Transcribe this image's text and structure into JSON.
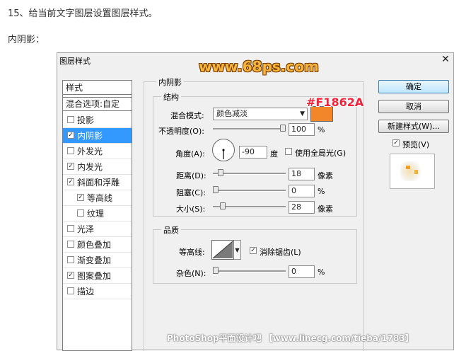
{
  "article": {
    "step_text": "15、给当前文字图层设置图层样式。",
    "section_label": "内阴影："
  },
  "dialog": {
    "title": "图层样式",
    "close_glyph": "✕",
    "watermark_top": "www.68ps.com",
    "watermark_bottom": "PhotoShop平面设计吧 【www.linecg.com/tieba/1783】"
  },
  "styles_panel": {
    "header": "样式",
    "blend_options": "混合选项:自定",
    "items": [
      {
        "label": "投影",
        "checked": false,
        "selected": false,
        "indent": false
      },
      {
        "label": "内阴影",
        "checked": true,
        "selected": true,
        "indent": false
      },
      {
        "label": "外发光",
        "checked": false,
        "selected": false,
        "indent": false
      },
      {
        "label": "内发光",
        "checked": true,
        "selected": false,
        "indent": false
      },
      {
        "label": "斜面和浮雕",
        "checked": true,
        "selected": false,
        "indent": false
      },
      {
        "label": "等高线",
        "checked": true,
        "selected": false,
        "indent": true
      },
      {
        "label": "纹理",
        "checked": false,
        "selected": false,
        "indent": true
      },
      {
        "label": "光泽",
        "checked": false,
        "selected": false,
        "indent": false
      },
      {
        "label": "颜色叠加",
        "checked": false,
        "selected": false,
        "indent": false
      },
      {
        "label": "渐变叠加",
        "checked": false,
        "selected": false,
        "indent": false
      },
      {
        "label": "图案叠加",
        "checked": true,
        "selected": false,
        "indent": false
      },
      {
        "label": "描边",
        "checked": false,
        "selected": false,
        "indent": false
      }
    ]
  },
  "inner_shadow": {
    "title": "内阴影",
    "structure_title": "结构",
    "blend_mode_label": "混合模式:",
    "blend_mode_value": "颜色减淡",
    "color_hex_label": "#F1862A",
    "color": "#f1862a",
    "opacity_label": "不透明度(O):",
    "opacity_value": "100",
    "opacity_unit": "%",
    "opacity_fraction": 1.0,
    "angle_label": "角度(A):",
    "angle_value": "-90",
    "angle_unit": "度",
    "angle_degrees": -90,
    "global_light_label": "使用全局光(G)",
    "global_light_checked": false,
    "distance_label": "距离(D):",
    "distance_value": "18",
    "distance_unit": "像素",
    "distance_fraction": 0.07,
    "choke_label": "阻塞(C):",
    "choke_value": "0",
    "choke_unit": "%",
    "choke_fraction": 0.0,
    "size_label": "大小(S):",
    "size_value": "28",
    "size_unit": "像素",
    "size_fraction": 0.11,
    "quality_title": "品质",
    "contour_label": "等高线:",
    "antialias_label": "消除锯齿(L)",
    "antialias_checked": true,
    "noise_label": "杂色(N):",
    "noise_value": "0",
    "noise_unit": "%",
    "noise_fraction": 0.0
  },
  "buttons": {
    "ok": "确定",
    "cancel": "取消",
    "new_style": "新建样式(W)...",
    "preview_label": "预览(V)",
    "preview_checked": true
  }
}
